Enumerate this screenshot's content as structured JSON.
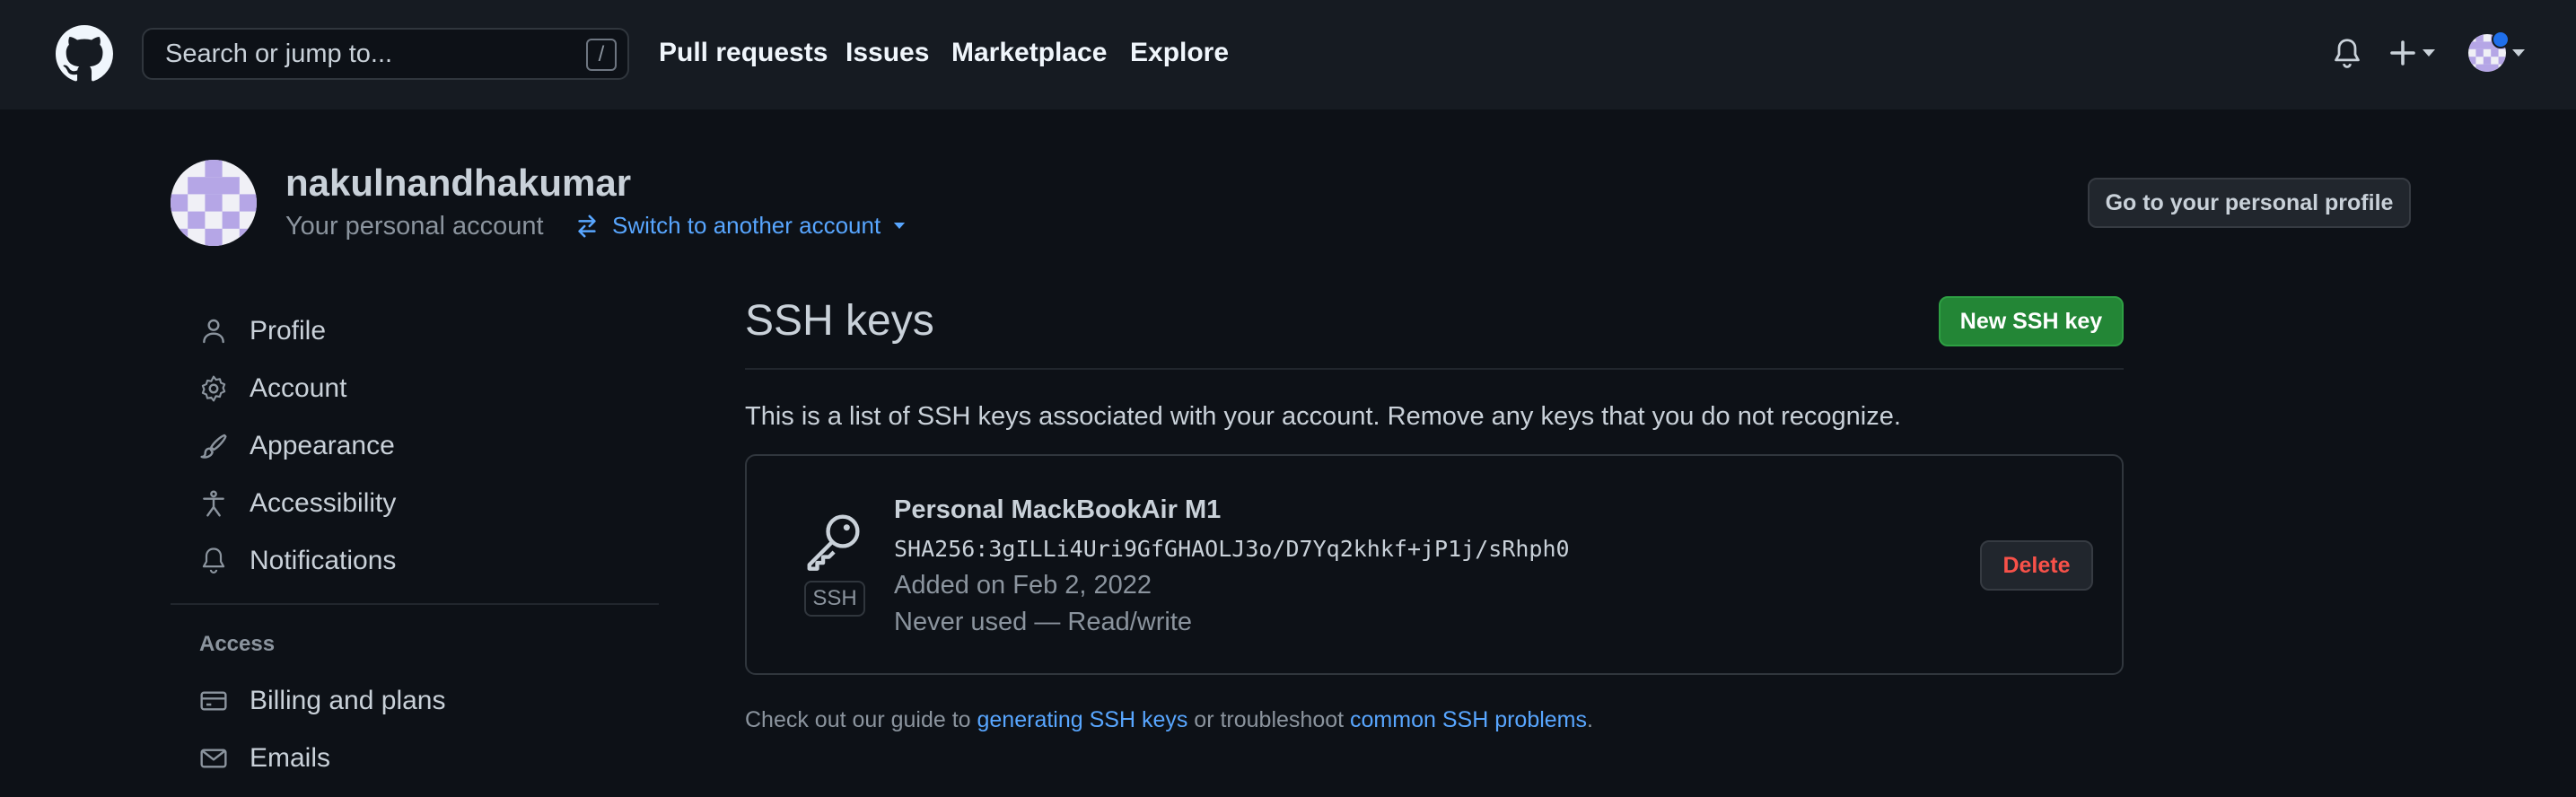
{
  "header": {
    "search_placeholder": "Search or jump to...",
    "search_shortcut": "/",
    "nav": [
      "Pull requests",
      "Issues",
      "Marketplace",
      "Explore"
    ]
  },
  "account": {
    "username": "nakulnandhakumar",
    "subtitle": "Your personal account",
    "switch_label": "Switch to another account",
    "profile_button": "Go to your personal profile"
  },
  "sidebar": {
    "items": [
      "Profile",
      "Account",
      "Appearance",
      "Accessibility",
      "Notifications"
    ],
    "access_heading": "Access",
    "access_items": [
      "Billing and plans",
      "Emails"
    ]
  },
  "main": {
    "title": "SSH keys",
    "new_button": "New SSH key",
    "intro": "This is a list of SSH keys associated with your account. Remove any keys that you do not recognize.",
    "key": {
      "badge": "SSH",
      "name": "Personal MackBookAir M1",
      "fingerprint": "SHA256:3gILLi4Uri9GfGHAOLJ3o/D7Yq2khkf+jP1j/sRhph0",
      "added": "Added on Feb 2, 2022",
      "usage": "Never used — Read/write",
      "delete_button": "Delete"
    },
    "footer": {
      "prefix": "Check out our guide to ",
      "link1": "generating SSH keys",
      "middle": " or troubleshoot ",
      "link2": "common SSH problems",
      "suffix": "."
    }
  },
  "colors": {
    "background": "#0d1117",
    "header": "#161b22",
    "link": "#58a6ff",
    "primary_button": "#238636",
    "danger": "#f85149",
    "notification_dot": "#1f6feb"
  }
}
